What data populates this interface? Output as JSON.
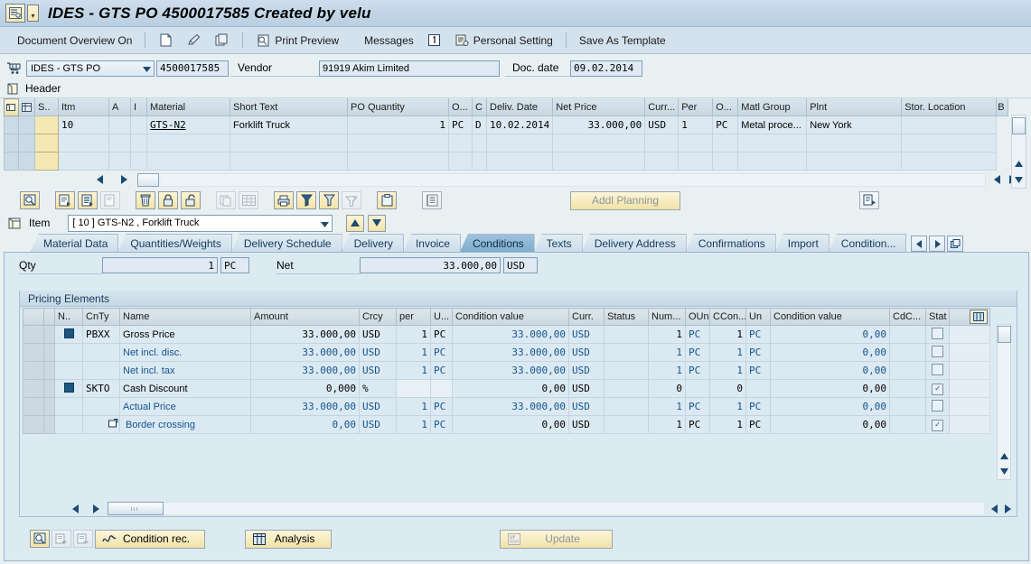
{
  "window": {
    "title": "IDES - GTS PO 4500017585 Created by velu",
    "sys_icon": "sap-logo-icon",
    "menu_arrow": "dropdown-arrow-icon"
  },
  "toolbar": {
    "document_overview": "Document Overview On",
    "icons": [
      "new-document-icon",
      "hold-pencil-icon",
      "check-document-icon"
    ],
    "print_preview": "Print Preview",
    "messages": "Messages",
    "personal_setting": "Personal Setting",
    "save_as_template": "Save As Template"
  },
  "doc_header": {
    "cart_icon": "shopping-cart-icon",
    "doc_type": "IDES - GTS PO",
    "doc_number": "4500017585",
    "vendor_label": "Vendor",
    "vendor_value": "91919 Akim Limited",
    "doc_date_label": "Doc. date",
    "doc_date_value": "09.02.2014",
    "header_label": "Header",
    "header_icon": "header-expand-icon"
  },
  "item_grid": {
    "columns": [
      "S..",
      "Itm",
      "A",
      "I",
      "Material",
      "Short Text",
      "PO Quantity",
      "O...",
      "C",
      "Deliv. Date",
      "Net Price",
      "Curr...",
      "Per",
      "O...",
      "Matl Group",
      "Plnt",
      "Stor. Location",
      "B"
    ],
    "rows": [
      {
        "sel": "",
        "itm": "10",
        "a": "",
        "i": "",
        "material": "GTS-N2",
        "short_text": "Forklift Truck",
        "po_quantity": "1",
        "ounit": "PC",
        "c": "D",
        "deliv_date": "10.02.2014",
        "net_price": "33.000,00",
        "curr": "USD",
        "per": "1",
        "o2": "PC",
        "matl_group": "Metal proce...",
        "plnt": "New York",
        "stor_location": "",
        "b": ""
      }
    ],
    "empty_rows": 2,
    "nav_left": "scroll-left-icon",
    "nav_right": "scroll-right-icon"
  },
  "mid_toolbar": {
    "buttons": [
      "detail-search-icon",
      "copy-row-icon",
      "insert-row-icon",
      "duplicate-row-icon",
      "delete-row-icon",
      "lock-icon",
      "unlock-icon",
      "copy-icon",
      "grid-icon",
      "print-icon",
      "filter-set-icon",
      "filter-icon",
      "sort-icon",
      "clipboard-icon",
      "list-icon"
    ],
    "addl_planning": "Addl Planning",
    "right_icon": "copy-document-icon"
  },
  "item_selector": {
    "folder_icon": "item-folder-icon",
    "label": "Item",
    "value": "[ 10 ] GTS-N2 , Forklift Truck",
    "up_icon": "arrow-up-icon",
    "down_icon": "arrow-down-icon"
  },
  "tabs": {
    "items": [
      "Material Data",
      "Quantities/Weights",
      "Delivery Schedule",
      "Delivery",
      "Invoice",
      "Conditions",
      "Texts",
      "Delivery Address",
      "Confirmations",
      "Import",
      "Condition..."
    ],
    "active": "Conditions",
    "nav_prev": "tab-prev-icon",
    "nav_next": "tab-next-icon",
    "nav_list": "tab-list-icon"
  },
  "conditions": {
    "qty_label": "Qty",
    "qty_value": "1",
    "qty_unit": "PC",
    "net_label": "Net",
    "net_value": "33.000,00",
    "net_currency": "USD",
    "group_title": "Pricing Elements",
    "columns": [
      "N..",
      "CnTy",
      "Name",
      "Amount",
      "Crcy",
      "per",
      "U...",
      "Condition value",
      "Curr.",
      "Status",
      "Num...",
      "OUn",
      "CCon...",
      "Un",
      "Condition value",
      "CdC...",
      "Stat"
    ],
    "grid_icon": "column-config-icon",
    "rows": [
      {
        "marker": "condition-type-icon",
        "cnty": "PBXX",
        "name": "Gross Price",
        "amount": "33.000,00",
        "crcy": "USD",
        "per": "1",
        "u": "PC",
        "cond_value": "33.000,00",
        "curr": "USD",
        "status": "",
        "num": "1",
        "oun": "PC",
        "ccon": "1",
        "un": "PC",
        "cond_value2": "0,00",
        "cdc": "",
        "stat": false,
        "style": "dark",
        "indent": 0
      },
      {
        "marker": "",
        "cnty": "",
        "name": "Net incl. disc.",
        "amount": "33.000,00",
        "crcy": "USD",
        "per": "1",
        "u": "PC",
        "cond_value": "33.000,00",
        "curr": "USD",
        "status": "",
        "num": "1",
        "oun": "PC",
        "ccon": "1",
        "un": "PC",
        "cond_value2": "0,00",
        "cdc": "",
        "stat": false,
        "style": "blue",
        "indent": 0
      },
      {
        "marker": "",
        "cnty": "",
        "name": "Net incl. tax",
        "amount": "33.000,00",
        "crcy": "USD",
        "per": "1",
        "u": "PC",
        "cond_value": "33.000,00",
        "curr": "USD",
        "status": "",
        "num": "1",
        "oun": "PC",
        "ccon": "1",
        "un": "PC",
        "cond_value2": "0,00",
        "cdc": "",
        "stat": false,
        "style": "blue",
        "indent": 0
      },
      {
        "marker": "condition-type-icon",
        "cnty": "SKTO",
        "name": "Cash Discount",
        "amount": "0,000",
        "crcy": "%",
        "per": "",
        "u": "",
        "cond_value": "0,00",
        "curr": "USD",
        "status": "",
        "num": "0",
        "oun": "",
        "ccon": "0",
        "un": "",
        "cond_value2": "0,00",
        "cdc": "",
        "stat": true,
        "style": "dark",
        "indent": 0
      },
      {
        "marker": "",
        "cnty": "",
        "name": "Actual Price",
        "amount": "33.000,00",
        "crcy": "USD",
        "per": "1",
        "u": "PC",
        "cond_value": "33.000,00",
        "curr": "USD",
        "status": "",
        "num": "1",
        "oun": "PC",
        "ccon": "1",
        "un": "PC",
        "cond_value2": "0,00",
        "cdc": "",
        "stat": false,
        "style": "blue",
        "indent": 0
      },
      {
        "marker": "subitem-icon",
        "cnty": "",
        "name": "Border crossing",
        "amount": "0,00",
        "crcy": "USD",
        "per": "1",
        "u": "PC",
        "cond_value": "0,00",
        "curr": "USD",
        "status": "",
        "num": "1",
        "oun": "PC",
        "ccon": "1",
        "un": "PC",
        "cond_value2": "0,00",
        "cdc": "",
        "stat": true,
        "style": "blue",
        "indent": 1
      }
    ]
  },
  "bottom_toolbar": {
    "icons": [
      "detail-search-icon",
      "insert-condition-icon",
      "delete-condition-icon"
    ],
    "condition_rec": "Condition rec.",
    "condition_rec_icon": "condition-record-icon",
    "analysis": "Analysis",
    "analysis_icon": "analysis-grid-icon",
    "update": "Update",
    "update_icon": "currency-update-icon"
  },
  "colors": {
    "window_bg": "#e9f0f2",
    "title_bg": "#c2d5e6",
    "toolbar_bg": "#d4e2ee",
    "active_tab": "#8fb8d6",
    "button_yellow": "#f1e2a6",
    "link_blue": "#14548c",
    "grid_row": "#dbe9f2"
  }
}
